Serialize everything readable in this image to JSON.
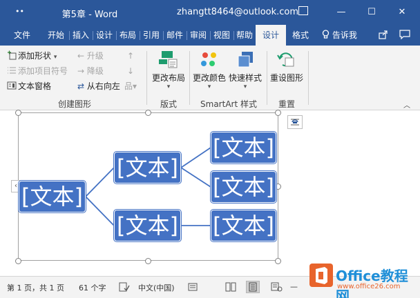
{
  "app": {
    "doc_title": "第5章 - Word",
    "account": "zhangtt8464@outlook.com",
    "qat_label": "••",
    "colors": {
      "accent": "#2b579a",
      "node_fill": "#4472c4",
      "ribbon_bg": "#f3f3f3"
    }
  },
  "window_controls": {
    "minimize": "—",
    "maximize": "☐",
    "close": "✕"
  },
  "tabs": [
    {
      "label": "文件"
    },
    {
      "label": "开始"
    },
    {
      "label": "插入"
    },
    {
      "label": "设计"
    },
    {
      "label": "布局"
    },
    {
      "label": "引用"
    },
    {
      "label": "邮件"
    },
    {
      "label": "审阅"
    },
    {
      "label": "视图"
    },
    {
      "label": "帮助"
    },
    {
      "label": "设计",
      "active": true
    },
    {
      "label": "格式"
    }
  ],
  "tell_me": "告诉我",
  "ribbon": {
    "create_graphic": {
      "add_shape": "添加形状",
      "add_bullet": "添加项目符号",
      "text_pane": "文本窗格",
      "promote": "升级",
      "demote": "降级",
      "right_to_left": "从右向左",
      "label": "创建图形"
    },
    "layouts": {
      "change_layout": "更改布局",
      "label": "版式"
    },
    "styles": {
      "change_colors": "更改颜色",
      "quick_styles": "快速样式",
      "label": "SmartArt 样式"
    },
    "reset": {
      "reset_graphic": "重设图形",
      "label": "重置"
    }
  },
  "smartart": {
    "nodes": [
      "[文本]",
      "[文本]",
      "[文本]",
      "[文本]",
      "[文本]",
      "[文本]"
    ]
  },
  "statusbar": {
    "page": "第 1 页，共 1 页",
    "words": "61 个字",
    "language": "中文(中国)"
  },
  "watermark": {
    "brand": "Office教程网",
    "url": "www.office26.com"
  }
}
